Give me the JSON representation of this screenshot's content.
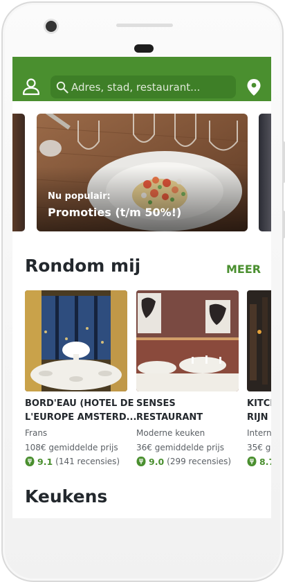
{
  "search": {
    "placeholder": "Adres, stad, restaurant..."
  },
  "featured": {
    "subtitle": "Nu populair:",
    "title": "Promoties (t/m 50%!)"
  },
  "nearby": {
    "title": "Rondom mij",
    "more_label": "MEER",
    "restaurants": [
      {
        "name_line1": "BORD'EAU (HOTEL DE",
        "name_line2": "L'EUROPE AMSTERD...",
        "cuisine": "Frans",
        "price": "108€ gemiddelde prijs",
        "score": "9.1",
        "reviews": "(141 recensies)"
      },
      {
        "name_line1": "SENSES",
        "name_line2": "RESTAURANT",
        "cuisine": "Moderne keuken",
        "price": "36€ gemiddelde prijs",
        "score": "9.0",
        "reviews": "(299 recensies)"
      },
      {
        "name_line1": "KITCH",
        "name_line2": "RIJN",
        "cuisine": "Internat",
        "price": "35€ ge",
        "score": "8.7",
        "reviews": ""
      }
    ]
  },
  "cuisines": {
    "title": "Keukens"
  },
  "colors": {
    "brand_green": "#4a8f2f",
    "search_bg": "#3e7f27",
    "heading": "#23282d"
  }
}
